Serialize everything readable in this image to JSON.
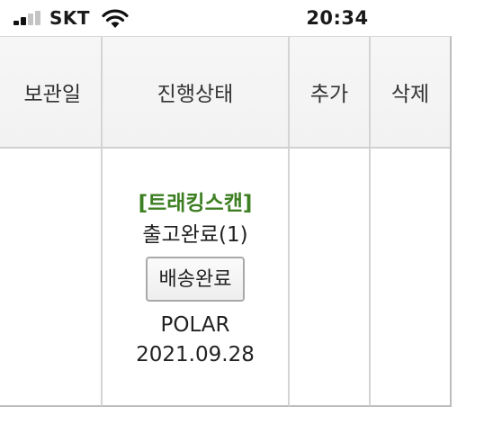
{
  "status_bar": {
    "carrier": "SKT",
    "time": "20:34",
    "signal_bars_active": 2,
    "signal_bars_total": 4
  },
  "table": {
    "headers": {
      "date": "보관일",
      "status": "진행상태",
      "add": "추가",
      "delete": "삭제"
    },
    "row": {
      "date": "",
      "tracking_link": "[트래킹스캔]",
      "status": "출고완료(1)",
      "delivery_button": "배송완료",
      "courier": "POLAR",
      "ship_date": "2021.09.28",
      "add": "",
      "delete": ""
    }
  },
  "colors": {
    "tracking_link": "#3d7f22",
    "header_bg": "#f4f4f4",
    "border": "#d4d4d4"
  }
}
